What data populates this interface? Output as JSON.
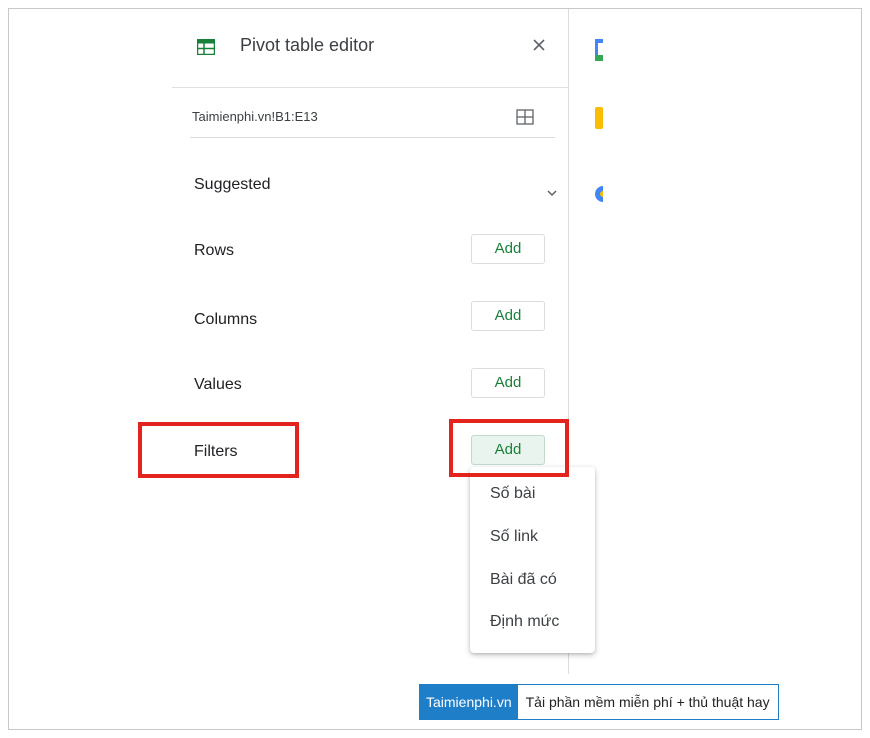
{
  "editor": {
    "title": "Pivot table editor",
    "range": "Taimienphi.vn!B1:E13",
    "icons": [
      "sheets-icon",
      "close-icon",
      "grid-select-icon",
      "chevron-down-icon"
    ],
    "accent_color": "#188038"
  },
  "sections": {
    "suggested": "Suggested",
    "rows": {
      "label": "Rows",
      "button": "Add"
    },
    "columns": {
      "label": "Columns",
      "button": "Add"
    },
    "values": {
      "label": "Values",
      "button": "Add"
    },
    "filters": {
      "label": "Filters",
      "button": "Add"
    }
  },
  "dropdown": {
    "items": [
      "Số bài",
      "Số link",
      "Bài đã có",
      "Định mức"
    ]
  },
  "highlight_color": "#e3231d",
  "watermark": {
    "brand": "Taimienphi.vn",
    "tagline": "Tải phần mềm miễn phí + thủ thuật hay"
  }
}
